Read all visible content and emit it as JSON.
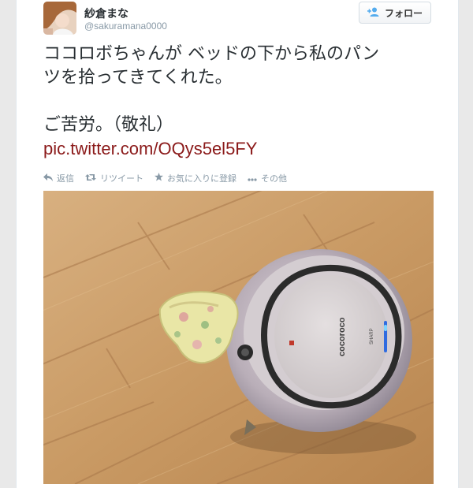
{
  "tweet": {
    "display_name": "紗倉まな",
    "handle": "@sakuramana0000",
    "follow_label": "フォロー",
    "text_lines": [
      "ココロボちゃんが ベッドの下から私のパン",
      "ツを拾ってきてくれた。",
      "",
      "ご苦労。（敬礼）"
    ],
    "link": "pic.twitter.com/OQys5el5FY"
  },
  "actions": {
    "reply": "返信",
    "retweet": "リツイート",
    "favorite": "お気に入りに登録",
    "more": "その他"
  },
  "colors": {
    "link": "#8b1a1a",
    "muted": "#8899a6",
    "text": "#292f33",
    "follow_icon": "#55acee"
  },
  "icons": [
    "avatar-image",
    "follow-person-plus-icon",
    "reply-icon",
    "retweet-icon",
    "star-icon",
    "ellipsis-icon"
  ]
}
